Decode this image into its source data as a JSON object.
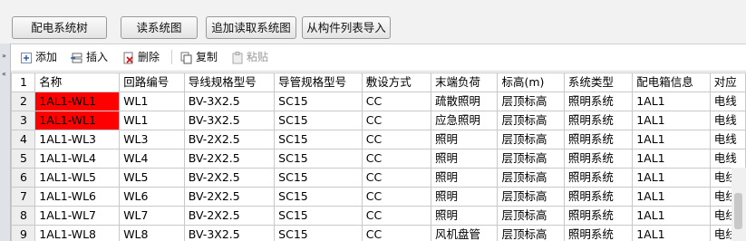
{
  "top_buttons": [
    "配电系统树",
    "读系统图",
    "追加读取系统图",
    "从构件列表导入"
  ],
  "toolbar": {
    "add": "添加",
    "insert": "插入",
    "delete": "删除",
    "copy": "复制",
    "paste": "粘贴"
  },
  "table": {
    "header_row_number": "1",
    "columns": [
      "名称",
      "回路编号",
      "导线规格型号",
      "导管规格型号",
      "敷设方式",
      "末端负荷",
      "标高(m)",
      "系统类型",
      "配电箱信息",
      "对应"
    ],
    "rows": [
      {
        "n": "2",
        "cells": [
          "1AL1-WL1",
          "WL1",
          "BV-3X2.5",
          "SC15",
          "CC",
          "疏散照明",
          "层顶标高",
          "照明系统",
          "1AL1",
          "电线"
        ],
        "highlight": true
      },
      {
        "n": "3",
        "cells": [
          "1AL1-WL1",
          "WL1",
          "BV-3X2.5",
          "SC15",
          "CC",
          "应急照明",
          "层顶标高",
          "照明系统",
          "1AL1",
          "电线"
        ],
        "highlight": true
      },
      {
        "n": "4",
        "cells": [
          "1AL1-WL3",
          "WL3",
          "BV-2X2.5",
          "SC15",
          "CC",
          "照明",
          "层顶标高",
          "照明系统",
          "1AL1",
          "电线"
        ],
        "highlight": false
      },
      {
        "n": "5",
        "cells": [
          "1AL1-WL4",
          "WL4",
          "BV-2X2.5",
          "SC15",
          "CC",
          "照明",
          "层顶标高",
          "照明系统",
          "1AL1",
          "电线"
        ],
        "highlight": false
      },
      {
        "n": "6",
        "cells": [
          "1AL1-WL5",
          "WL5",
          "BV-2X2.5",
          "SC15",
          "CC",
          "照明",
          "层顶标高",
          "照明系统",
          "1AL1",
          "电线"
        ],
        "highlight": false
      },
      {
        "n": "7",
        "cells": [
          "1AL1-WL6",
          "WL6",
          "BV-2X2.5",
          "SC15",
          "CC",
          "照明",
          "层顶标高",
          "照明系统",
          "1AL1",
          "电线"
        ],
        "highlight": false
      },
      {
        "n": "8",
        "cells": [
          "1AL1-WL7",
          "WL7",
          "BV-2X2.5",
          "SC15",
          "CC",
          "照明",
          "层顶标高",
          "照明系统",
          "1AL1",
          "电线"
        ],
        "highlight": false
      },
      {
        "n": "9",
        "cells": [
          "1AL1-WL8",
          "WL8",
          "BV-3X2.5",
          "SC15",
          "CC",
          "风机盘管",
          "层顶标高",
          "照明系统",
          "1AL1",
          "电线"
        ],
        "highlight": false
      }
    ]
  }
}
